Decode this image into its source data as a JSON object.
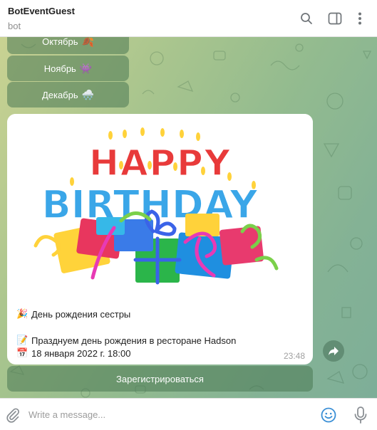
{
  "header": {
    "title": "BotEventGuest",
    "subtitle": "bot",
    "icons": [
      "search-icon",
      "sidebar-toggle-icon",
      "more-vertical-icon"
    ]
  },
  "keyboard": {
    "buttons": [
      {
        "label": "Октябрь",
        "emoji": "🍂"
      },
      {
        "label": "Ноябрь",
        "emoji": "👾"
      },
      {
        "label": "Декабрь",
        "emoji": "🌨️"
      }
    ]
  },
  "message": {
    "image_text": {
      "line1": "HAPPY",
      "line2": "BIRTHDAY"
    },
    "title_emoji": "🎉",
    "title": "День рождения сестры",
    "desc_emoji": "📝",
    "description": "Празднуем день рождения в ресторане Hadson",
    "date_emoji": "📅",
    "date": "18 января 2022 г. 18:00",
    "time": "23:48",
    "inline_button": "Зарегистрироваться"
  },
  "composer": {
    "placeholder": "Write a message..."
  },
  "colors": {
    "accent": "#3a8fd6",
    "button_bg": "rgba(74,120,84,0.55)",
    "chat_bg": "#a9c58e"
  }
}
